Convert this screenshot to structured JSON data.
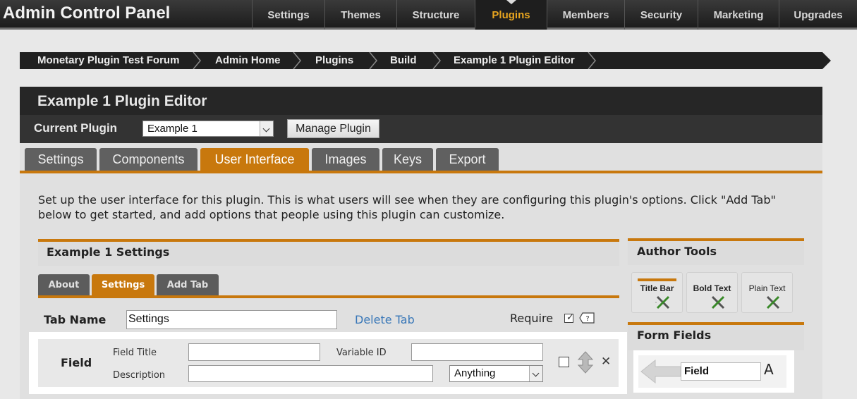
{
  "app": {
    "title": "Admin Control Panel"
  },
  "nav": {
    "items": [
      {
        "label": "Settings"
      },
      {
        "label": "Themes"
      },
      {
        "label": "Structure"
      },
      {
        "label": "Plugins"
      },
      {
        "label": "Members"
      },
      {
        "label": "Security"
      },
      {
        "label": "Marketing"
      },
      {
        "label": "Upgrades"
      }
    ],
    "active": "Plugins"
  },
  "breadcrumb": {
    "items": [
      {
        "label": "Monetary Plugin Test Forum"
      },
      {
        "label": "Admin Home"
      },
      {
        "label": "Plugins"
      },
      {
        "label": "Build"
      },
      {
        "label": "Example 1 Plugin Editor"
      }
    ]
  },
  "editor": {
    "title": "Example 1 Plugin Editor",
    "current_plugin_label": "Current Plugin",
    "current_plugin_value": "Example 1",
    "manage_button": "Manage Plugin",
    "tabs": [
      {
        "label": "Settings"
      },
      {
        "label": "Components"
      },
      {
        "label": "User Interface"
      },
      {
        "label": "Images"
      },
      {
        "label": "Keys"
      },
      {
        "label": "Export"
      }
    ],
    "active_tab": "User Interface",
    "intro": "Set up the user interface for this plugin. This is what users will see when they are configuring this plugin's options. Click \"Add Tab\" below to get started, and add options that people using this plugin can customize."
  },
  "settings_panel": {
    "title": "Example 1 Settings",
    "subtabs": [
      {
        "label": "About"
      },
      {
        "label": "Settings"
      },
      {
        "label": "Add Tab"
      }
    ],
    "active_subtab": "Settings",
    "tab_name_label": "Tab Name",
    "tab_name_value": "Settings",
    "delete_tab": "Delete Tab",
    "require_label": "Require",
    "require_checked": true
  },
  "field_row": {
    "label": "Field",
    "field_title_label": "Field Title",
    "field_title_value": "",
    "variable_id_label": "Variable ID",
    "variable_id_value": "",
    "description_label": "Description",
    "description_value": "",
    "type_value": "Anything"
  },
  "author_tools": {
    "title": "Author Tools",
    "tools": [
      {
        "label": "Title Bar"
      },
      {
        "label": "Bold Text"
      },
      {
        "label": "Plain Text"
      }
    ]
  },
  "form_fields": {
    "title": "Form Fields",
    "field_tool_label": "Field",
    "field_tool_suffix": "A"
  },
  "colors": {
    "accent": "#c8780d",
    "nav_active": "#e8a51f",
    "link": "#3a78b8",
    "dark": "#262626"
  }
}
